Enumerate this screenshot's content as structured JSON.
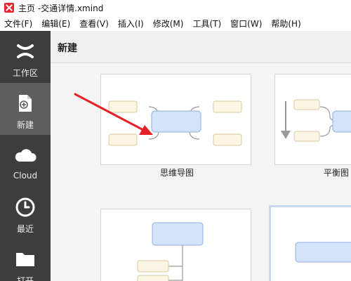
{
  "window": {
    "title": "主页 -交通详情.xmind"
  },
  "menu": [
    {
      "label": "文件(F)"
    },
    {
      "label": "编辑(E)"
    },
    {
      "label": "查看(V)"
    },
    {
      "label": "插入(I)"
    },
    {
      "label": "修改(M)"
    },
    {
      "label": "工具(T)"
    },
    {
      "label": "窗口(W)"
    },
    {
      "label": "帮助(H)"
    }
  ],
  "sidebar": {
    "items": [
      {
        "label": "工作区",
        "icon": "workspace-x-icon",
        "active": false
      },
      {
        "label": "新建",
        "icon": "new-file-icon",
        "active": true
      },
      {
        "label": "Cloud",
        "icon": "cloud-icon",
        "active": false
      },
      {
        "label": "最近",
        "icon": "clock-icon",
        "active": false
      },
      {
        "label": "打开",
        "icon": "folder-icon",
        "active": false
      }
    ]
  },
  "main": {
    "title": "新建",
    "templates": [
      {
        "label": "思维导图"
      },
      {
        "label": "平衡图"
      }
    ]
  },
  "colors": {
    "sidebar_bg": "#3d3d3d",
    "sidebar_active": "#5e5e5e",
    "node_central": "#d3e4fa",
    "node_sub": "#fbf5e4",
    "arrow": "#e8202a"
  }
}
